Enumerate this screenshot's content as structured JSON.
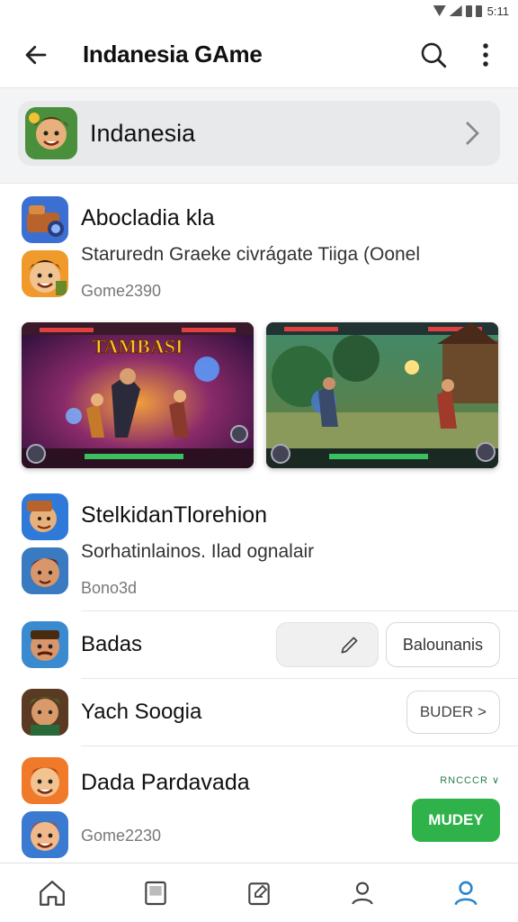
{
  "status": {
    "time": "5:11"
  },
  "app_bar": {
    "title": "Indanesia GAme",
    "back_icon": "arrow-left-icon",
    "search_icon": "search-icon",
    "more_icon": "more-vertical-icon"
  },
  "banner": {
    "title": "Indanesia",
    "icon": "chevron-right-icon"
  },
  "feature1": {
    "title": "Abocladia kla",
    "subtitle": "Staruredn Graeke civrágate Tiiga (Oonel",
    "meta": "Gome2390",
    "screenshots": [
      {
        "caption": "TAMBASI"
      },
      {
        "caption": ""
      }
    ]
  },
  "feature2": {
    "title": "StelkidanTlorehion",
    "subtitle": "Sorhatinlainos. Ilad ognalair",
    "meta": "Bono3d"
  },
  "rows": [
    {
      "title": "Badas",
      "action_label": "Balounanis",
      "edit_icon": "pencil-icon"
    },
    {
      "title": "Yach Soogia",
      "action_label": "BUDER >"
    },
    {
      "title": "Dada Pardavada",
      "meta": "Gome2230",
      "small_label": "RNCCCR ∨",
      "action_label": "MUDEY"
    }
  ],
  "accent": "#2fb24a",
  "bottom_nav": [
    "home-icon",
    "book-icon",
    "edit-note-icon",
    "profile-icon",
    "account-icon"
  ],
  "bottom_nav_active": "#2a84c9"
}
